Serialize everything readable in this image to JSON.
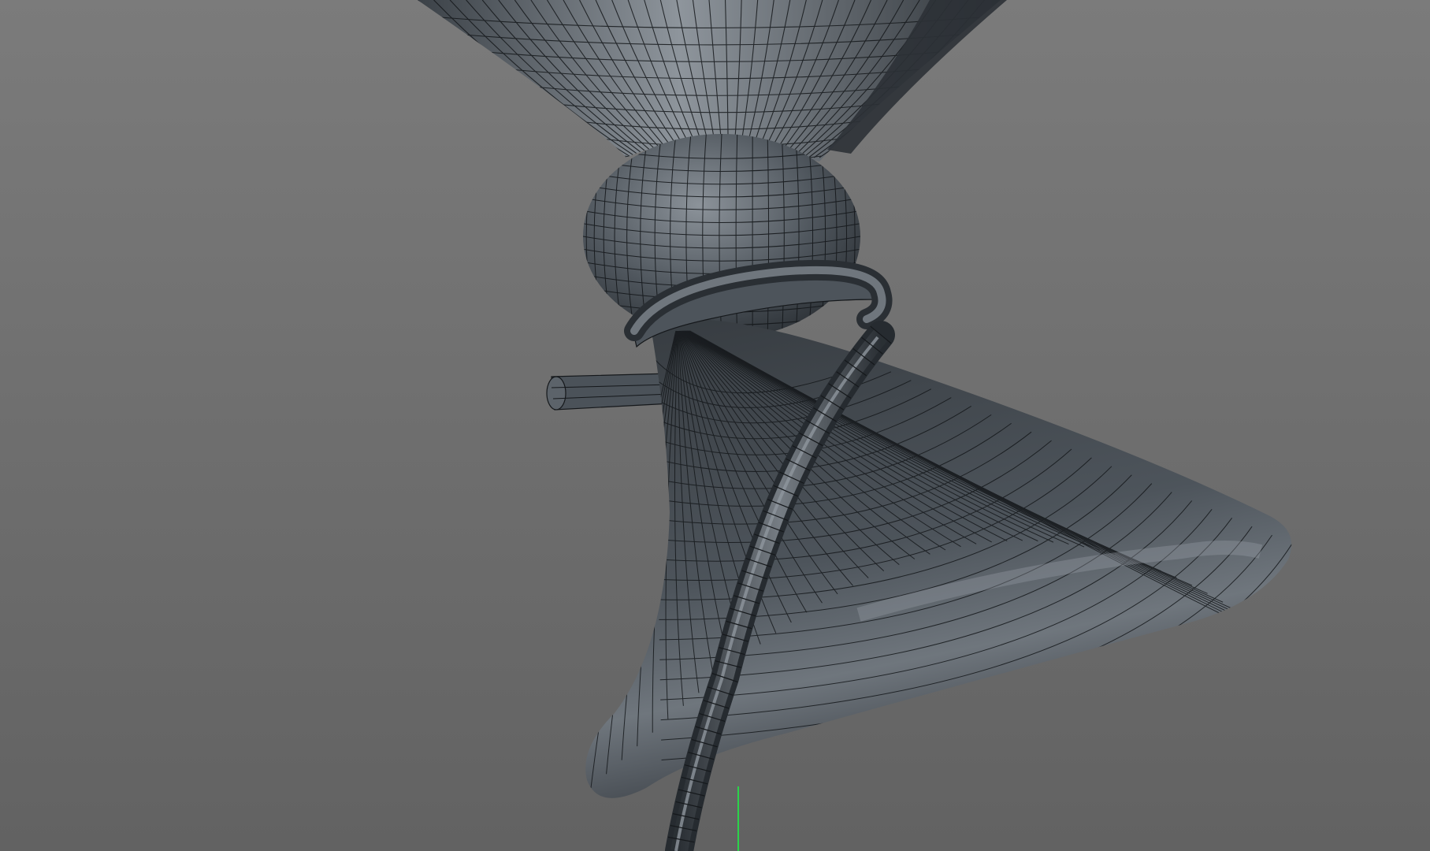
{
  "viewport": {
    "background_top": "#7b7b7b",
    "background_bottom": "#626262",
    "mesh_color": "#4a5158",
    "mesh_highlight": "#8e959c",
    "mesh_shadow": "#2c3136",
    "wire_color": "#15181b",
    "axis_color": "#2bd34a"
  }
}
